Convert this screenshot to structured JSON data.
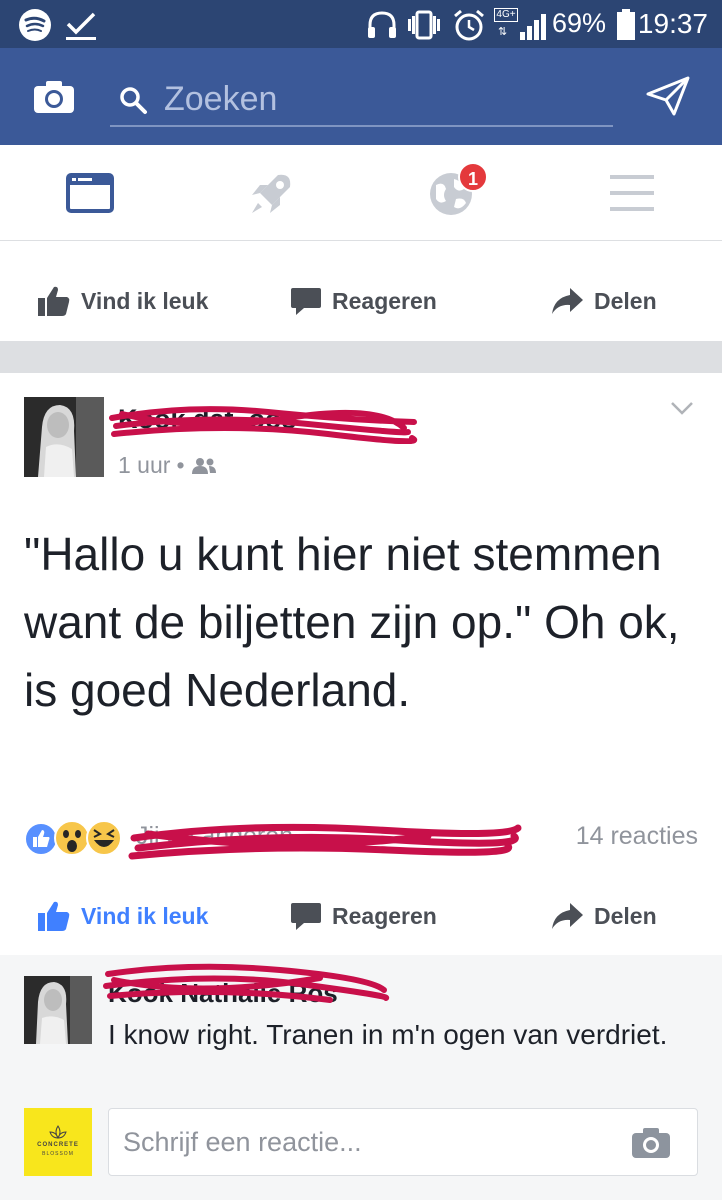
{
  "status_bar": {
    "icons": [
      "spotify-icon",
      "download-done-icon",
      "headphones-icon",
      "vibrate-icon",
      "alarm-icon",
      "4g-lte-icon",
      "signal-icon",
      "battery-icon"
    ],
    "network": "4G+",
    "battery": "69%",
    "time": "19:37"
  },
  "header": {
    "search_placeholder": "Zoeken",
    "icons": [
      "camera-icon",
      "search-icon",
      "messenger-icon"
    ]
  },
  "nav": {
    "tabs": [
      "news-feed-icon",
      "rocket-icon",
      "globe-icon",
      "menu-icon"
    ],
    "notification_count": "1"
  },
  "top_actions": {
    "like": "Vind ik leuk",
    "comment": "Reageren",
    "share": "Delen"
  },
  "post": {
    "author": "Kook dat. oos",
    "time": "1 uur",
    "text": "\"Hallo u kunt hier niet stemmen want de biljetten zijn op.\" Oh ok, is goed Nederland.",
    "reactions_names": "Jij en anderen",
    "reactions_count": "14 reacties",
    "liked": true
  },
  "post_actions": {
    "like": "Vind ik leuk",
    "comment": "Reageren",
    "share": "Delen"
  },
  "comment": {
    "author": "Kook Nathalie Ros",
    "text": "I know right. Tranen in m'n ogen van verdriet."
  },
  "reply": {
    "placeholder": "Schrijf een reactie...",
    "page_logo": "CONCRETE",
    "page_logo_sub": "BLOSSOM"
  },
  "colors": {
    "brand": "#3b5998",
    "status": "#2c4573",
    "like_blue": "#4080ff",
    "scribble": "#c8104a",
    "badge": "#e4393c"
  }
}
